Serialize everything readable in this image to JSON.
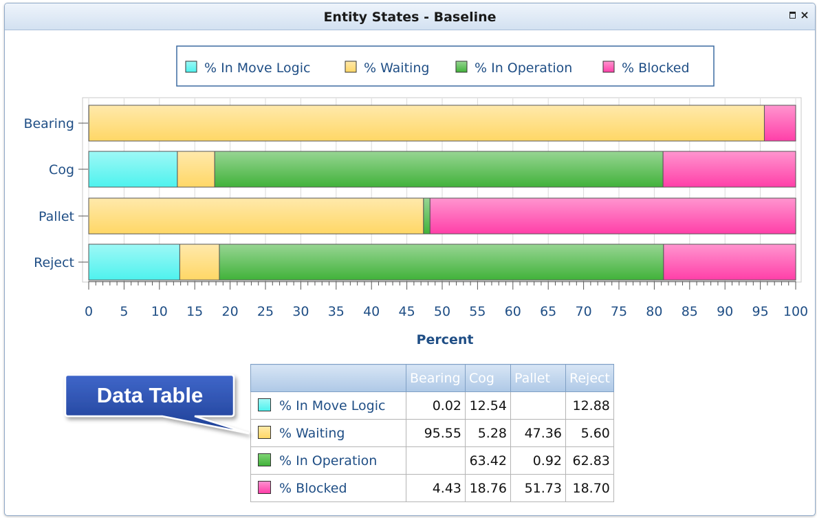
{
  "window": {
    "title": "Entity States - Baseline"
  },
  "colors": {
    "move_logic": "#4ef2ee",
    "waiting": "#ffd766",
    "operation": "#41b23a",
    "blocked": "#ff3fa8",
    "text_blue": "#1f4e85"
  },
  "chart_data": {
    "type": "bar",
    "orientation": "horizontal",
    "stacked": true,
    "title": "",
    "xlabel": "Percent",
    "ylabel": "",
    "xlim": [
      0,
      100
    ],
    "x_ticks": [
      "0",
      "5",
      "10",
      "15",
      "20",
      "25",
      "30",
      "35",
      "40",
      "45",
      "50",
      "55",
      "60",
      "65",
      "70",
      "75",
      "80",
      "85",
      "90",
      "95",
      "100"
    ],
    "categories": [
      "Bearing",
      "Cog",
      "Pallet",
      "Reject"
    ],
    "series": [
      {
        "name": "% In Move Logic",
        "color": "#4ef2ee",
        "values": [
          0.02,
          12.54,
          0,
          12.88
        ]
      },
      {
        "name": "% Waiting",
        "color": "#ffd766",
        "values": [
          95.55,
          5.28,
          47.36,
          5.6
        ]
      },
      {
        "name": "% In Operation",
        "color": "#41b23a",
        "values": [
          0,
          63.42,
          0.92,
          62.83
        ]
      },
      {
        "name": "% Blocked",
        "color": "#ff3fa8",
        "values": [
          4.43,
          18.76,
          51.73,
          18.7
        ]
      }
    ],
    "legend_position": "top"
  },
  "data_table": {
    "headers": [
      "",
      "Bearing",
      "Cog",
      "Pallet",
      "Reject"
    ],
    "rows": [
      {
        "label": "% In Move Logic",
        "color": "#4ef2ee",
        "cells": [
          "0.02",
          "12.54",
          "",
          "12.88"
        ]
      },
      {
        "label": "% Waiting",
        "color": "#ffd766",
        "cells": [
          "95.55",
          "5.28",
          "47.36",
          "5.60"
        ]
      },
      {
        "label": "% In Operation",
        "color": "#41b23a",
        "cells": [
          "",
          "63.42",
          "0.92",
          "62.83"
        ]
      },
      {
        "label": "% Blocked",
        "color": "#ff3fa8",
        "cells": [
          "4.43",
          "18.76",
          "51.73",
          "18.70"
        ]
      }
    ]
  },
  "callout": {
    "label": "Data Table"
  }
}
